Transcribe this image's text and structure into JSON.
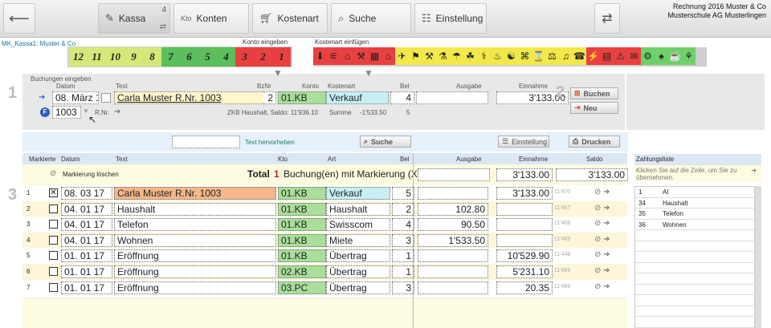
{
  "window": {
    "company_line1": "Rechnung 2016 Muster & Co",
    "company_line2": "Musterschule AG Musterlingen"
  },
  "nav": {
    "tabs": [
      {
        "label": "Kassa",
        "badge": "4"
      },
      {
        "label": "Konten",
        "prefix": "Kto"
      },
      {
        "label": "Kostenart"
      },
      {
        "label": "Suche"
      },
      {
        "label": "Einstellung"
      }
    ]
  },
  "codes": {
    "file_label": "MK_Kassa1: Muster & Co",
    "konto_label": "Konto eingeben",
    "kostenart_label": "Kostenart einfügen",
    "tiles": [
      {
        "t": "12",
        "bg": "#d4e87a"
      },
      {
        "t": "11",
        "bg": "#d4e87a"
      },
      {
        "t": "10",
        "bg": "#d4e87a"
      },
      {
        "t": "9",
        "bg": "#d4e87a"
      },
      {
        "t": "8",
        "bg": "#d4e87a"
      },
      {
        "t": "7",
        "bg": "#5bbf5b"
      },
      {
        "t": "6",
        "bg": "#5bbf5b"
      },
      {
        "t": "5",
        "bg": "#5bbf5b"
      },
      {
        "t": "4",
        "bg": "#5bbf5b"
      },
      {
        "t": "3",
        "bg": "#e84040"
      },
      {
        "t": "2",
        "bg": "#e84040"
      },
      {
        "t": "1",
        "bg": "#e84040"
      }
    ],
    "cat_red": "#e84040",
    "cat_yellow": "#f2e84a",
    "cat_green": "#6fd06a"
  },
  "form": {
    "section_num": "1",
    "title": "Buchungen eingeben",
    "col_datum": "Datum",
    "col_text": "Text",
    "col_bznr": "BzNr",
    "col_konto": "Konto",
    "col_kostenart": "Kostenart",
    "col_bel": "Bel",
    "col_ausgabe": "Ausgabe",
    "col_einnahme": "Einnahme",
    "datum": "08. März 17",
    "text": "Carla  Muster  R.Nr. 1003",
    "bznr": "2",
    "konto": "01.KB",
    "kostenart": "Verkauf",
    "bel": "4",
    "ausgabe": "",
    "einnahme": "3'133.00",
    "rnr_value": "1003",
    "rnr_label": "R.Nr.",
    "saldo_info": "ZKB Haushalt, Saldo: 11'936.10",
    "summe_label": "Summe",
    "summe_value": "-1'533.50",
    "summe_count": "5",
    "section2": "2",
    "buchen": "Buchen",
    "neu": "Neu"
  },
  "toolbar": {
    "hervorheben": "Text hervorheben",
    "suche": "Suche",
    "einstellung": "Einstellung",
    "drucken": "Drucken"
  },
  "table": {
    "section_num": "3",
    "headers": {
      "markierte": "Markierte",
      "datum": "Datum",
      "text": "Text",
      "kto": "Kto",
      "art": "Art",
      "bel": "Bel",
      "ausgabe": "Ausgabe",
      "einnahme": "Einnahme",
      "saldo": "Saldo"
    },
    "summary": {
      "clear": "Markierung löschen",
      "total_label": "Total",
      "total_count": "1",
      "total_text": "Buchung(en) mit Markierung (X)",
      "einnahme": "3'133.00",
      "saldo": "3'133.00"
    },
    "rows": [
      {
        "n": "1",
        "checked": true,
        "datum": "08. 03 17",
        "text": "Carla  Muster  R.Nr. 1003",
        "kto": "01.KB",
        "art": "Verkauf",
        "bel": "5",
        "ausgabe": "",
        "einnahme": "3'133.00",
        "saldo": "11'470",
        "text_bg": "#f4b88a",
        "art_bg": "#c8f0f4"
      },
      {
        "n": "2",
        "checked": false,
        "datum": "04. 01 17",
        "text": "Haushalt",
        "kto": "01.KB",
        "art": "Haushalt",
        "bel": "2",
        "ausgabe": "102.80",
        "einnahme": "",
        "saldo": "11'467"
      },
      {
        "n": "3",
        "checked": false,
        "datum": "04. 01 17",
        "text": "Telefon",
        "kto": "01.KB",
        "art": "Swisscom",
        "bel": "4",
        "ausgabe": "90.50",
        "einnahme": "",
        "saldo": "11'468"
      },
      {
        "n": "4",
        "checked": false,
        "datum": "04. 01 17",
        "text": "Wohnen",
        "kto": "01.KB",
        "art": "Miete",
        "bel": "3",
        "ausgabe": "1'533.50",
        "einnahme": "",
        "saldo": "11'469"
      },
      {
        "n": "5",
        "checked": false,
        "datum": "01. 01 17",
        "text": "Eröffnung",
        "kto": "01.KB",
        "art": "Übertrag",
        "bel": "1",
        "ausgabe": "",
        "einnahme": "10'529.90",
        "saldo": "11'448"
      },
      {
        "n": "6",
        "checked": false,
        "datum": "01. 01 17",
        "text": "Eröffnung",
        "kto": "02.KB",
        "art": "Übertrag",
        "bel": "1",
        "ausgabe": "",
        "einnahme": "5'231.10",
        "saldo": "11'465"
      },
      {
        "n": "7",
        "checked": false,
        "datum": "01. 01 17",
        "text": "Eröffnung",
        "kto": "03.PC",
        "art": "Übertrag",
        "bel": "3",
        "ausgabe": "",
        "einnahme": "20.35",
        "saldo": "11'466"
      }
    ]
  },
  "zahlungsliste": {
    "title": "Zahlungsliste",
    "hint": "Klicken Sie auf die Zeile, um Sie zu übernehmen.",
    "items": [
      {
        "n": "1",
        "t": "AI"
      },
      {
        "n": "34",
        "t": "Haushalt"
      },
      {
        "n": "35",
        "t": "Telefon"
      },
      {
        "n": "36",
        "t": "Wohnen"
      }
    ]
  }
}
